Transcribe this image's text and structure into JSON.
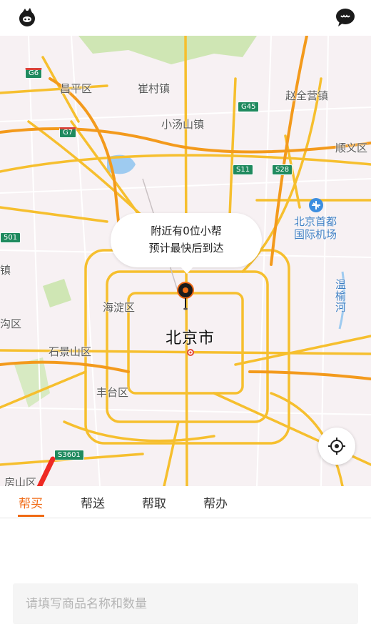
{
  "header": {
    "left_icon": "mascot-avatar-icon",
    "right_icon": "chat-bubble-icon"
  },
  "map": {
    "city": "北京市",
    "labels": {
      "changping": "昌平区",
      "cuicun": "崔村镇",
      "zhaoquanying": "赵全营镇",
      "xiaotangshan": "小汤山镇",
      "shunyi": "顺义区",
      "airport_l1": "北京首都",
      "airport_l2": "国际机场",
      "haidian": "海淀区",
      "shijingshan": "石景山区",
      "fengtai": "丰台区",
      "fangshan": "房山区",
      "mentougou": "沟区",
      "zhen": "镇",
      "wenyu": "温榆河"
    },
    "shields": {
      "g6": "G6",
      "g45": "G45",
      "g7": "G7",
      "s11": "S11",
      "s28": "S28",
      "s501": "501",
      "s3601": "S3601"
    }
  },
  "bubble": {
    "line1": "附近有0位小帮",
    "line2": "预计最快后到达"
  },
  "tabs": [
    {
      "label": "帮买",
      "active": true
    },
    {
      "label": "帮送",
      "active": false
    },
    {
      "label": "帮取",
      "active": false
    },
    {
      "label": "帮办",
      "active": false
    }
  ],
  "form": {
    "placeholder": "请填写商品名称和数量"
  },
  "colors": {
    "accent": "#f06a14",
    "road": "#f6bf2e",
    "highway_shield": "#1f8a5e"
  }
}
